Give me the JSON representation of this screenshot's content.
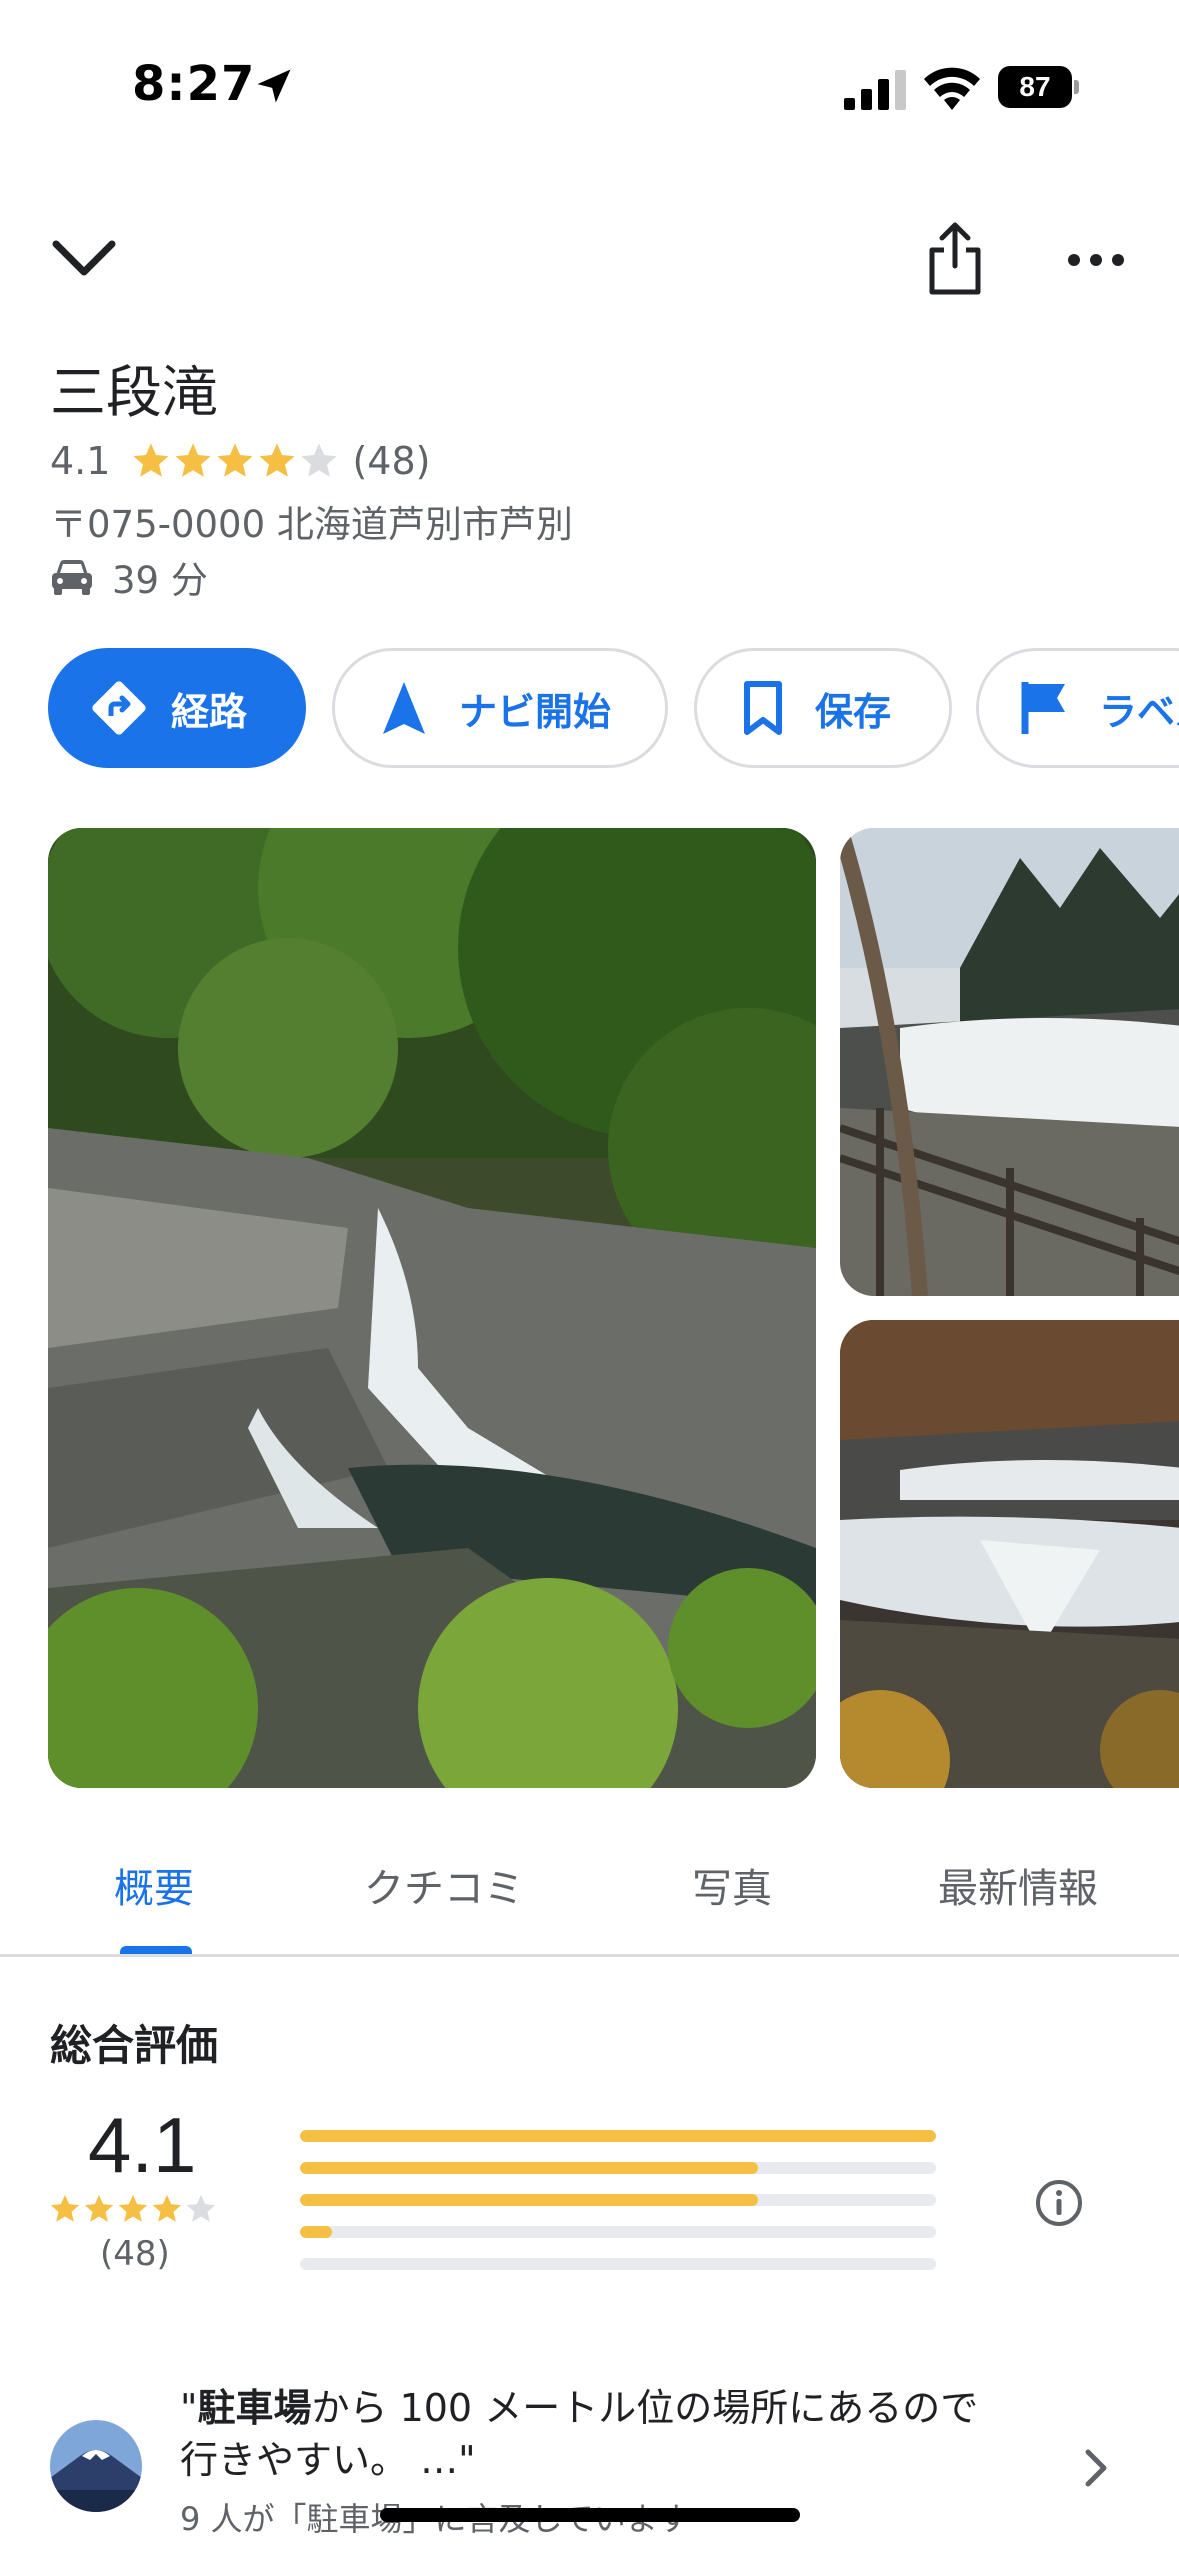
{
  "status_bar": {
    "time": "8:27",
    "battery": "87"
  },
  "place": {
    "name": "三段滝",
    "rating": "4.1",
    "review_count": "(48)",
    "stars_filled": 4,
    "address": "〒075-0000 北海道芦別市芦別",
    "travel_time": "39 分"
  },
  "actions": {
    "directions": "経路",
    "start": "ナビ開始",
    "save": "保存",
    "label": "ラベル"
  },
  "tabs": [
    "概要",
    "クチコミ",
    "写真",
    "最新情報"
  ],
  "active_tab": "概要",
  "summary": {
    "title": "総合評価",
    "score": "4.1",
    "count": "(48)",
    "distribution": [
      {
        "stars": 5,
        "fraction": 1.0
      },
      {
        "stars": 4,
        "fraction": 0.72
      },
      {
        "stars": 3,
        "fraction": 0.72
      },
      {
        "stars": 2,
        "fraction": 0.05
      },
      {
        "stars": 1,
        "fraction": 0.0
      }
    ]
  },
  "review_highlight": {
    "keyword": "駐車場",
    "quote_rest": "から 100 メートル位の場所にあるので",
    "quote_line2": "行きやすい。 …\"",
    "quote_open": "\"",
    "mention": "9 人が「駐車場」に言及しています"
  },
  "colors": {
    "accent": "#1a73e8",
    "star": "#f4bf42",
    "muted": "#5f6368"
  },
  "icons": [
    "location-arrow-icon",
    "signal-icon",
    "wifi-icon",
    "chevron-down-icon",
    "share-icon",
    "more-icon",
    "car-icon",
    "directions-icon",
    "navigate-icon",
    "bookmark-icon",
    "flag-icon",
    "info-icon",
    "chevron-right-icon"
  ]
}
